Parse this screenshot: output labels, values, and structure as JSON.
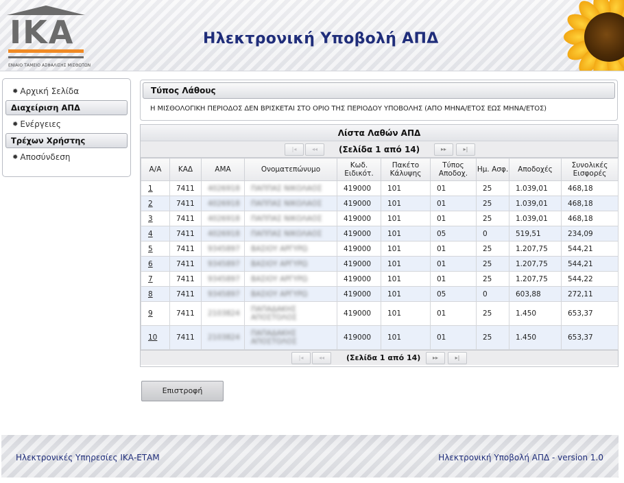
{
  "header": {
    "logo_text": "IKA",
    "logo_subtitle": "ΕΝΙΑΙΟ ΤΑΜΕΙΟ ΑΣΦΑΛΙΣΗΣ ΜΙΣΘΩΤΩΝ",
    "title": "Ηλεκτρονική Υποβολή ΑΠΔ",
    "accent_color": "#1f2d7a",
    "logo_color": "#6b6b6b",
    "logo_bar_color": "#f08a24"
  },
  "sidebar": {
    "home": "Αρχική Σελίδα",
    "group_apd": "Διαχείριση ΑΠΔ",
    "actions": "Ενέργειες",
    "group_user": "Τρέχων Χρήστης",
    "logout": "Αποσύνδεση",
    "bullet_icon": "gear-icon"
  },
  "error_panel": {
    "title": "Τύπος Λάθους",
    "message": "Η ΜΙΣΘΟΛΟΓΙΚΗ ΠΕΡΙΟΔΟΣ ΔΕΝ ΒΡΙΣΚΕΤΑΙ ΣΤΟ ΟΡΙΟ ΤΗΣ ΠΕΡΙΟΔΟΥ ΥΠΟΒΟΛΗΣ (ΑΠΟ ΜΗΝΑ/ΕΤΟΣ ΕΩΣ ΜΗΝΑ/ΕΤΟΣ)"
  },
  "list": {
    "title": "Λίστα Λαθών ΑΠΔ",
    "pager_label": "(Σελίδα 1 από 14)",
    "current_page": 1,
    "total_pages": 14,
    "pager_icons": {
      "first": "first-page-icon",
      "prev": "prev-page-icon",
      "next": "next-page-icon",
      "last": "last-page-icon"
    },
    "columns": [
      "Α/Α",
      "ΚΑΔ",
      "ΑΜΑ",
      "Ονοματεπώνυμο",
      "Κωδ. Ειδικότ.",
      "Πακέτο Κάλυψης",
      "Τύπος Αποδοχ.",
      "Ημ. Ασφ.",
      "Αποδοχές",
      "Συνολικές Εισφορές"
    ],
    "rows": [
      {
        "aa": "1",
        "kad": "7411",
        "ama": "4026918",
        "name": "ΠΑΠΠΑΣ ΝΙΚΟΛΑΟΣ",
        "eid": "419000",
        "paketo": "101",
        "typos": "01",
        "hm": "25",
        "apodoxes": "1.039,01",
        "eisfores": "468,18"
      },
      {
        "aa": "2",
        "kad": "7411",
        "ama": "4026918",
        "name": "ΠΑΠΠΑΣ ΝΙΚΟΛΑΟΣ",
        "eid": "419000",
        "paketo": "101",
        "typos": "01",
        "hm": "25",
        "apodoxes": "1.039,01",
        "eisfores": "468,18"
      },
      {
        "aa": "3",
        "kad": "7411",
        "ama": "4026918",
        "name": "ΠΑΠΠΑΣ ΝΙΚΟΛΑΟΣ",
        "eid": "419000",
        "paketo": "101",
        "typos": "01",
        "hm": "25",
        "apodoxes": "1.039,01",
        "eisfores": "468,18"
      },
      {
        "aa": "4",
        "kad": "7411",
        "ama": "4026918",
        "name": "ΠΑΠΠΑΣ ΝΙΚΟΛΑΟΣ",
        "eid": "419000",
        "paketo": "101",
        "typos": "05",
        "hm": "0",
        "apodoxes": "519,51",
        "eisfores": "234,09"
      },
      {
        "aa": "5",
        "kad": "7411",
        "ama": "9345897",
        "name": "ΒΑΣΙΟΥ ΑΡΓΥΡΩ",
        "eid": "419000",
        "paketo": "101",
        "typos": "01",
        "hm": "25",
        "apodoxes": "1.207,75",
        "eisfores": "544,21"
      },
      {
        "aa": "6",
        "kad": "7411",
        "ama": "9345897",
        "name": "ΒΑΣΙΟΥ ΑΡΓΥΡΩ",
        "eid": "419000",
        "paketo": "101",
        "typos": "01",
        "hm": "25",
        "apodoxes": "1.207,75",
        "eisfores": "544,21"
      },
      {
        "aa": "7",
        "kad": "7411",
        "ama": "9345897",
        "name": "ΒΑΣΙΟΥ ΑΡΓΥΡΩ",
        "eid": "419000",
        "paketo": "101",
        "typos": "01",
        "hm": "25",
        "apodoxes": "1.207,75",
        "eisfores": "544,22"
      },
      {
        "aa": "8",
        "kad": "7411",
        "ama": "9345897",
        "name": "ΒΑΣΙΟΥ ΑΡΓΥΡΩ",
        "eid": "419000",
        "paketo": "101",
        "typos": "05",
        "hm": "0",
        "apodoxes": "603,88",
        "eisfores": "272,11"
      },
      {
        "aa": "9",
        "kad": "7411",
        "ama": "2103824",
        "name": "ΠΑΠΑΔΑΚΗΣ ΑΠΟΣΤΟΛΟΣ",
        "eid": "419000",
        "paketo": "101",
        "typos": "01",
        "hm": "25",
        "apodoxes": "1.450",
        "eisfores": "653,37"
      },
      {
        "aa": "10",
        "kad": "7411",
        "ama": "2103824",
        "name": "ΠΑΠΑΔΑΚΗΣ ΑΠΟΣΤΟΛΟΣ",
        "eid": "419000",
        "paketo": "101",
        "typos": "01",
        "hm": "25",
        "apodoxes": "1.450",
        "eisfores": "653,37"
      }
    ]
  },
  "actions": {
    "return_label": "Επιστροφή"
  },
  "footer": {
    "left": "Ηλεκτρονικές Υπηρεσίες ΙΚΑ-ΕΤΑΜ",
    "right": "Ηλεκτρονική Υποβολή ΑΠΔ - version 1.0"
  }
}
